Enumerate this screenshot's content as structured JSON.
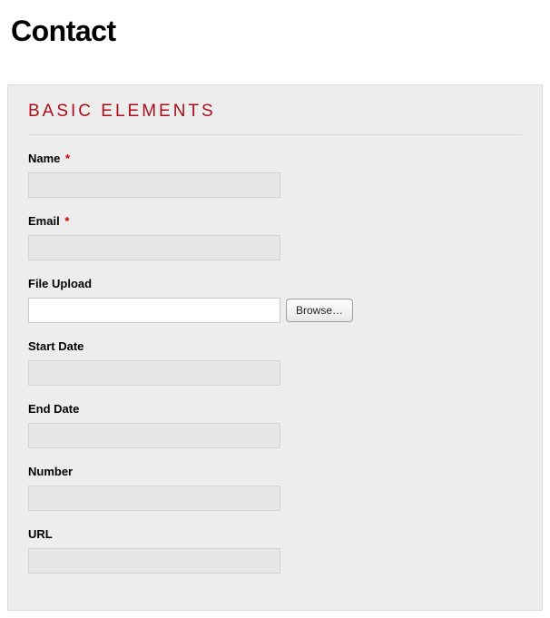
{
  "page": {
    "title": "Contact"
  },
  "section": {
    "title": "BASIC ELEMENTS"
  },
  "fields": {
    "name": {
      "label": "Name",
      "required_mark": "*",
      "value": ""
    },
    "email": {
      "label": "Email",
      "required_mark": "*",
      "value": ""
    },
    "file_upload": {
      "label": "File Upload",
      "value": "",
      "browse_label": "Browse…"
    },
    "start_date": {
      "label": "Start Date",
      "value": ""
    },
    "end_date": {
      "label": "End Date",
      "value": ""
    },
    "number": {
      "label": "Number",
      "value": ""
    },
    "url": {
      "label": "URL",
      "value": ""
    }
  }
}
